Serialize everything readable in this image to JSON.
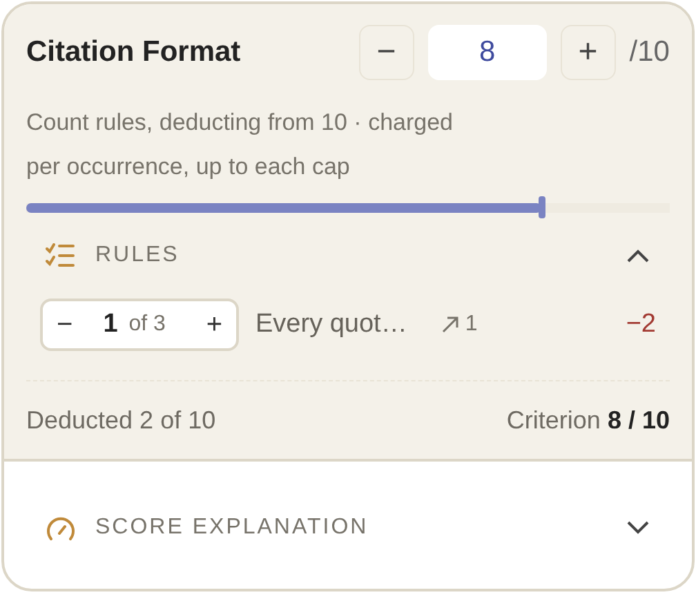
{
  "criterion": {
    "title": "Citation Format",
    "score": "8",
    "max": "/10",
    "decrement": "−",
    "increment": "+",
    "description": "Count rules, deducting from 10 · charged per occurrence, up to each cap",
    "level": 0.8
  },
  "rules": {
    "title": "RULES",
    "expanded": true,
    "items": [
      {
        "minus": "−",
        "plus": "+",
        "index": "1",
        "of": "of 3",
        "text": "Every quot…",
        "hits": "1",
        "deduction": "−2"
      }
    ]
  },
  "footer": {
    "deducted": "Deducted 2 of 10",
    "criterion": "Criterion **8 / 10**"
  },
  "explanation": {
    "title": "SCORE EXPLANATION",
    "expanded": false
  }
}
